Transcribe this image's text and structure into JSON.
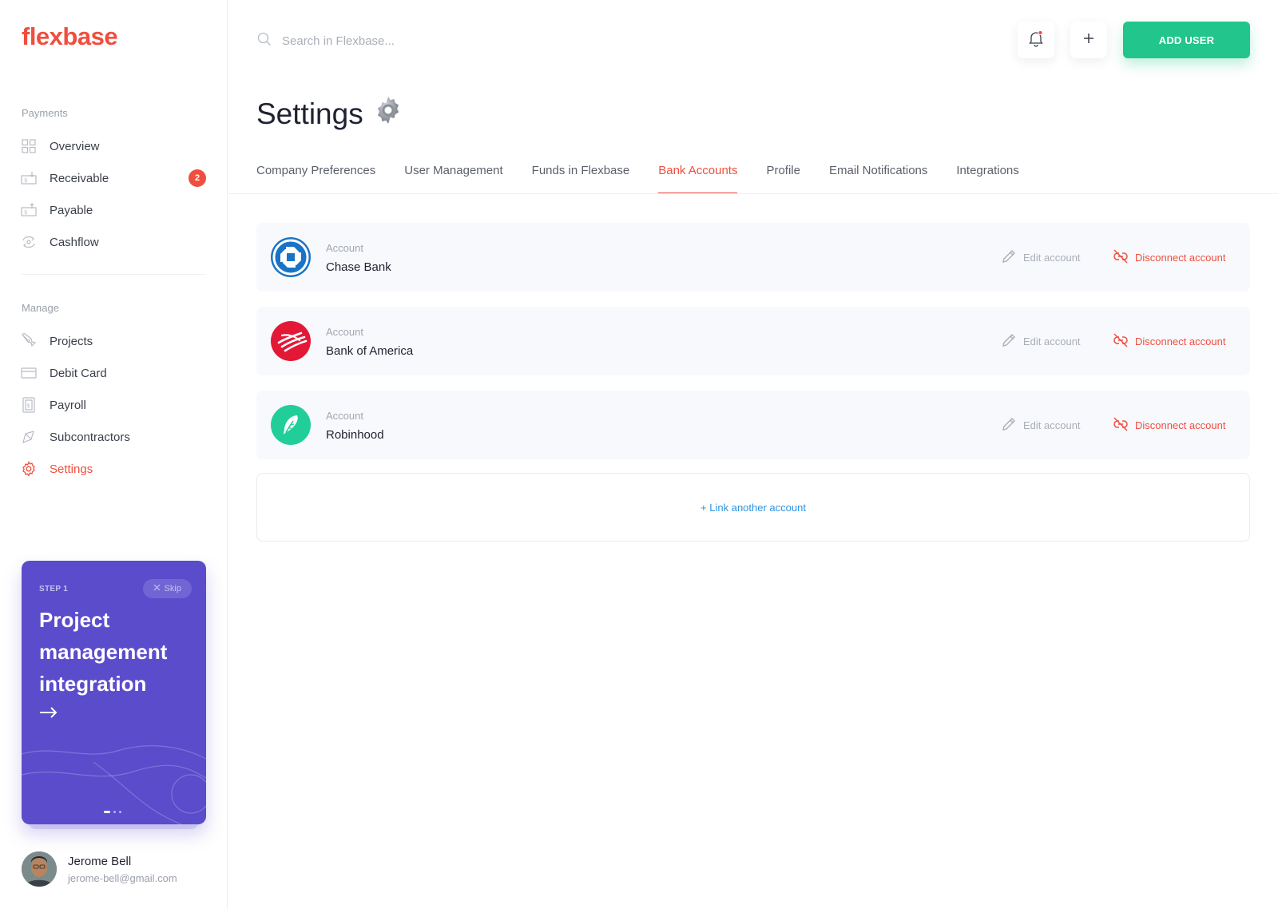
{
  "app": {
    "logo": "flexbase"
  },
  "sidebar": {
    "payments_label": "Payments",
    "manage_label": "Manage",
    "payments_items": [
      {
        "label": "Overview",
        "icon": "grid-icon"
      },
      {
        "label": "Receivable",
        "icon": "money-in-icon",
        "badge": "2"
      },
      {
        "label": "Payable",
        "icon": "money-out-icon"
      },
      {
        "label": "Cashflow",
        "icon": "cashflow-icon"
      }
    ],
    "manage_items": [
      {
        "label": "Projects",
        "icon": "pen-tool-icon"
      },
      {
        "label": "Debit Card",
        "icon": "card-icon"
      },
      {
        "label": "Payroll",
        "icon": "payroll-icon"
      },
      {
        "label": "Subcontractors",
        "icon": "subcontractor-icon"
      },
      {
        "label": "Settings",
        "icon": "gear-icon",
        "active": true
      }
    ]
  },
  "promo": {
    "step": "STEP 1",
    "skip_label": "Skip",
    "title": "Project management integration"
  },
  "user": {
    "name": "Jerome Bell",
    "email": "jerome-bell@gmail.com"
  },
  "topbar": {
    "search_placeholder": "Search in Flexbase...",
    "add_user_label": "ADD USER",
    "add_icon_label": "+"
  },
  "page": {
    "title": "Settings"
  },
  "tabs": [
    {
      "label": "Company Preferences"
    },
    {
      "label": "User Management"
    },
    {
      "label": "Funds in Flexbase"
    },
    {
      "label": "Bank Accounts",
      "active": true
    },
    {
      "label": "Profile"
    },
    {
      "label": "Email Notifications"
    },
    {
      "label": "Integrations"
    }
  ],
  "accounts": [
    {
      "label": "Account",
      "name": "Chase Bank",
      "edit_label": "Edit account",
      "disconnect_label": "Disconnect account",
      "brand_color": "#1a74c6"
    },
    {
      "label": "Account",
      "name": "Bank of America",
      "edit_label": "Edit account",
      "disconnect_label": "Disconnect account",
      "brand_color": "#e31837"
    },
    {
      "label": "Account",
      "name": "Robinhood",
      "edit_label": "Edit account",
      "disconnect_label": "Disconnect account",
      "brand_color": "#21ce99"
    }
  ],
  "link_another": "+ Link another account",
  "colors": {
    "accent": "#f04e3e",
    "primary_button": "#22c58b",
    "promo_bg": "#5b4ccc",
    "link": "#2c93e0"
  }
}
